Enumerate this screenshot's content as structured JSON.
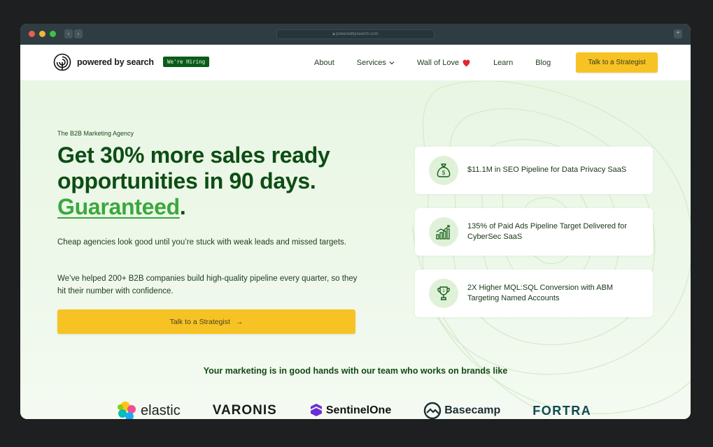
{
  "browser": {
    "url": "poweredbysearch.com",
    "dot_colors": [
      "#ee5d4f",
      "#f2b632",
      "#3ec244"
    ]
  },
  "header": {
    "logo_text": "powered by search",
    "hiring_badge": "We're Hiring",
    "nav": [
      {
        "label": "About"
      },
      {
        "label": "Services",
        "has_dropdown": true
      },
      {
        "label": "Wall of Love",
        "icon": "heart-icon"
      },
      {
        "label": "Learn"
      },
      {
        "label": "Blog"
      }
    ],
    "cta": "Talk to a Strategist"
  },
  "hero": {
    "eyebrow": "The B2B Marketing Agency",
    "headline_line1": "Get 30% more sales ready",
    "headline_line2": "opportunities in 90 days.",
    "headline_accent": "Guaranteed",
    "headline_period": ".",
    "paragraph1": "Cheap agencies look good until you’re stuck with weak leads and missed targets.",
    "paragraph2": "We’ve helped 200+ B2B companies build high-quality pipeline every quarter, so they hit their number with confidence.",
    "cta": "Talk to a Strategist",
    "cta_arrow": "→"
  },
  "stats": [
    {
      "icon": "money-bag-icon",
      "text": "$11.1M in SEO Pipeline for Data Privacy SaaS"
    },
    {
      "icon": "growth-chart-icon",
      "text": "135% of Paid Ads Pipeline Target Delivered for CyberSec SaaS"
    },
    {
      "icon": "trophy-icon",
      "text": "2X Higher MQL:SQL Conversion with ABM Targeting Named Accounts"
    }
  ],
  "brands": {
    "title": "Your marketing is in good hands with our team who works on brands like",
    "logos": [
      "elastic",
      "VARONIS",
      "SentinelOne",
      "Basecamp",
      "FORTRA"
    ]
  },
  "colors": {
    "brand_green": "#0d4d14",
    "accent_green": "#3aa83d",
    "cta_yellow": "#f7c324",
    "hero_bg": "#e9f6e4"
  }
}
